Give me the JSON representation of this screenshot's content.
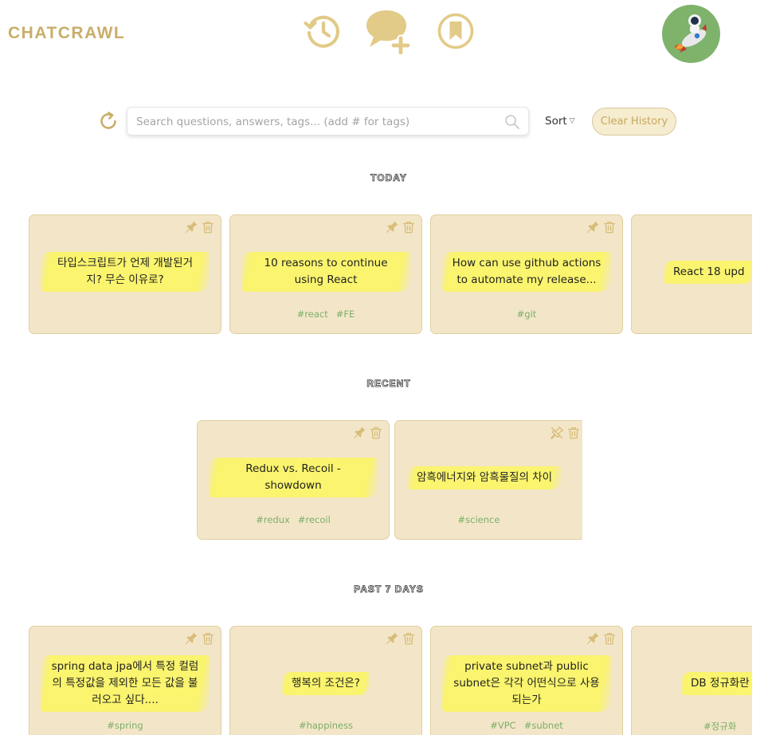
{
  "header": {
    "logo": "CHATCRAWL",
    "nav": [
      {
        "name": "history",
        "icon": "history-icon"
      },
      {
        "name": "new-chat",
        "icon": "chat-plus-icon"
      },
      {
        "name": "bookmarks",
        "icon": "bookmark-icon"
      }
    ],
    "avatar_icon": "astronaut-rocket-icon"
  },
  "search": {
    "placeholder": "Search questions, answers, tags... (add # for tags)",
    "value": ""
  },
  "toolbar": {
    "sort_label": "Sort",
    "clear_label": "Clear History"
  },
  "colors": {
    "brand": "#c9ae69",
    "card_bg": "#f3e6c8",
    "highlight": "#faf46e",
    "tag": "#7cae68",
    "avatar_bg": "#7fb36c"
  },
  "sections": {
    "today": {
      "title": "TODAY",
      "cards": [
        {
          "title": "타입스크립트가 언제 개발된거지? 무슨 이유로?",
          "tags": [],
          "pinned": false
        },
        {
          "title": "10 reasons to continue using React",
          "tags": [
            "#react",
            "#FE"
          ],
          "pinned": false
        },
        {
          "title": "How can use github actions to automate my release...",
          "tags": [
            "#git"
          ],
          "pinned": false
        },
        {
          "title": "React 18 upd",
          "tags": [],
          "pinned": false
        }
      ]
    },
    "recent": {
      "title": "RECENT",
      "cards": [
        {
          "title": "Redux vs. Recoil - showdown",
          "tags": [
            "#redux",
            "#recoil"
          ],
          "pinned": false
        },
        {
          "title": "암흑에너지와 암흑물질의 차이",
          "tags": [
            "#science"
          ],
          "pinned": true
        }
      ]
    },
    "past7": {
      "title": "PAST 7 DAYS",
      "cards": [
        {
          "title": "spring data jpa에서 특정 컬럼의 특정값을 제외한 모든 값을 불러오고 싶다....",
          "tags": [
            "#spring"
          ],
          "pinned": false
        },
        {
          "title": "행복의 조건은?",
          "tags": [
            "#happiness"
          ],
          "pinned": false
        },
        {
          "title": "private subnet과 public subnet은 각각 어떤식으로 사용되는가",
          "tags": [
            "#VPC",
            "#subnet"
          ],
          "pinned": false
        },
        {
          "title": "DB 정규화란",
          "tags": [
            "#정규화"
          ],
          "pinned": false
        }
      ]
    }
  }
}
